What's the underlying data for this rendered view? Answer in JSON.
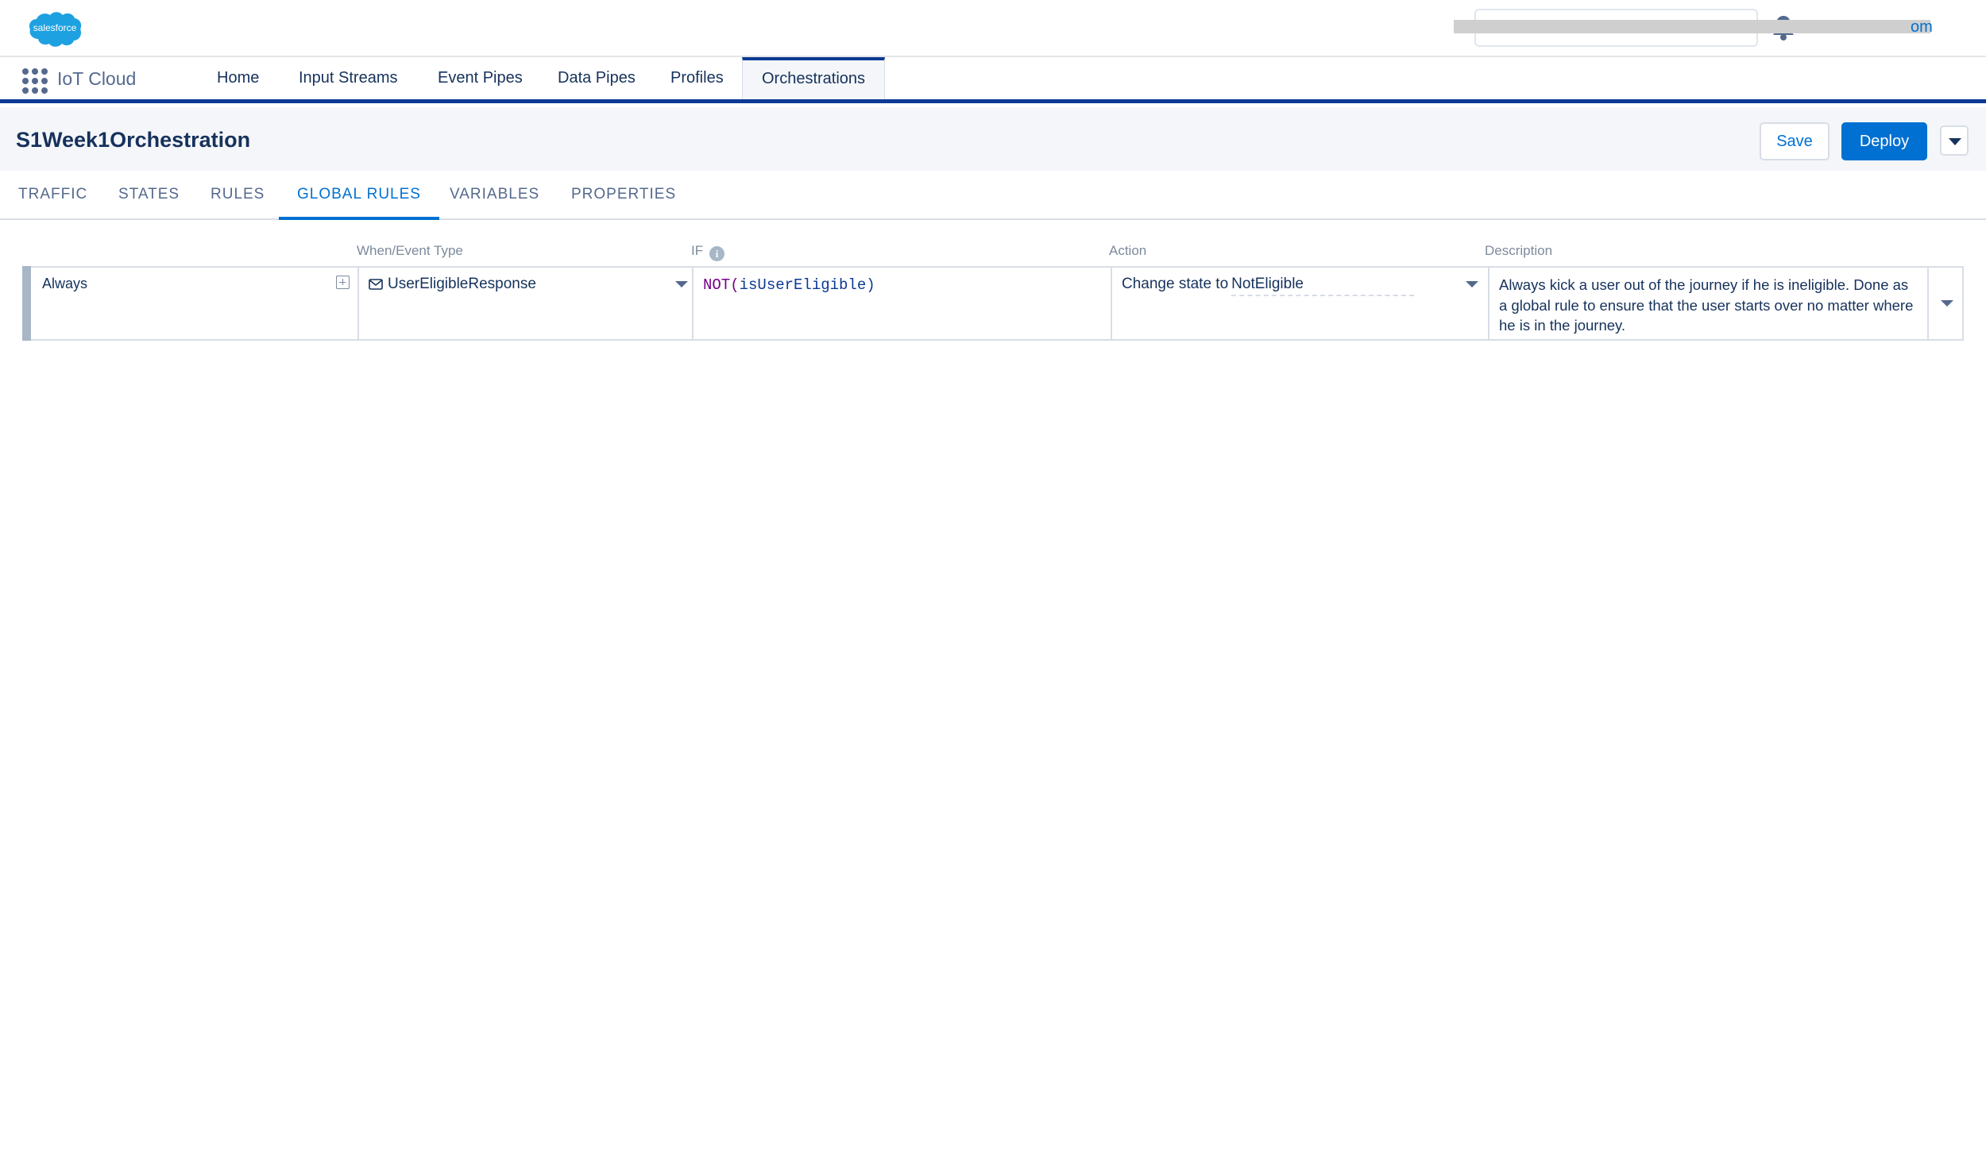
{
  "global_header": {
    "logo_text": "salesforce",
    "user_email_suffix": "om"
  },
  "app_nav": {
    "app_name": "IoT Cloud",
    "items": [
      {
        "label": "Home"
      },
      {
        "label": "Input Streams"
      },
      {
        "label": "Event Pipes"
      },
      {
        "label": "Data Pipes"
      },
      {
        "label": "Profiles"
      },
      {
        "label": "Orchestrations",
        "active": true
      }
    ]
  },
  "page": {
    "title": "S1Week1Orchestration",
    "save_label": "Save",
    "deploy_label": "Deploy"
  },
  "tabs": [
    {
      "label": "TRAFFIC"
    },
    {
      "label": "STATES"
    },
    {
      "label": "RULES"
    },
    {
      "label": "GLOBAL RULES",
      "active": true
    },
    {
      "label": "VARIABLES"
    },
    {
      "label": "PROPERTIES"
    }
  ],
  "table": {
    "headers": {
      "when": "When/Event Type",
      "if": "IF",
      "action": "Action",
      "description": "Description"
    },
    "rows": [
      {
        "when": "Always",
        "event_type": "UserEligibleResponse",
        "condition_fn": "NOT(",
        "condition_arg": "isUserEligible",
        "condition_close": ")",
        "action_prefix": "Change state to",
        "action_value": "NotEligible",
        "description": "Always kick a user out of the journey if he is ineligible. Done as a global rule to ensure that the user starts over no matter where he is in the journey."
      }
    ]
  },
  "colors": {
    "brand_blue": "#0070d2",
    "nav_underline": "#0b3a94",
    "text_primary": "#16325c"
  }
}
